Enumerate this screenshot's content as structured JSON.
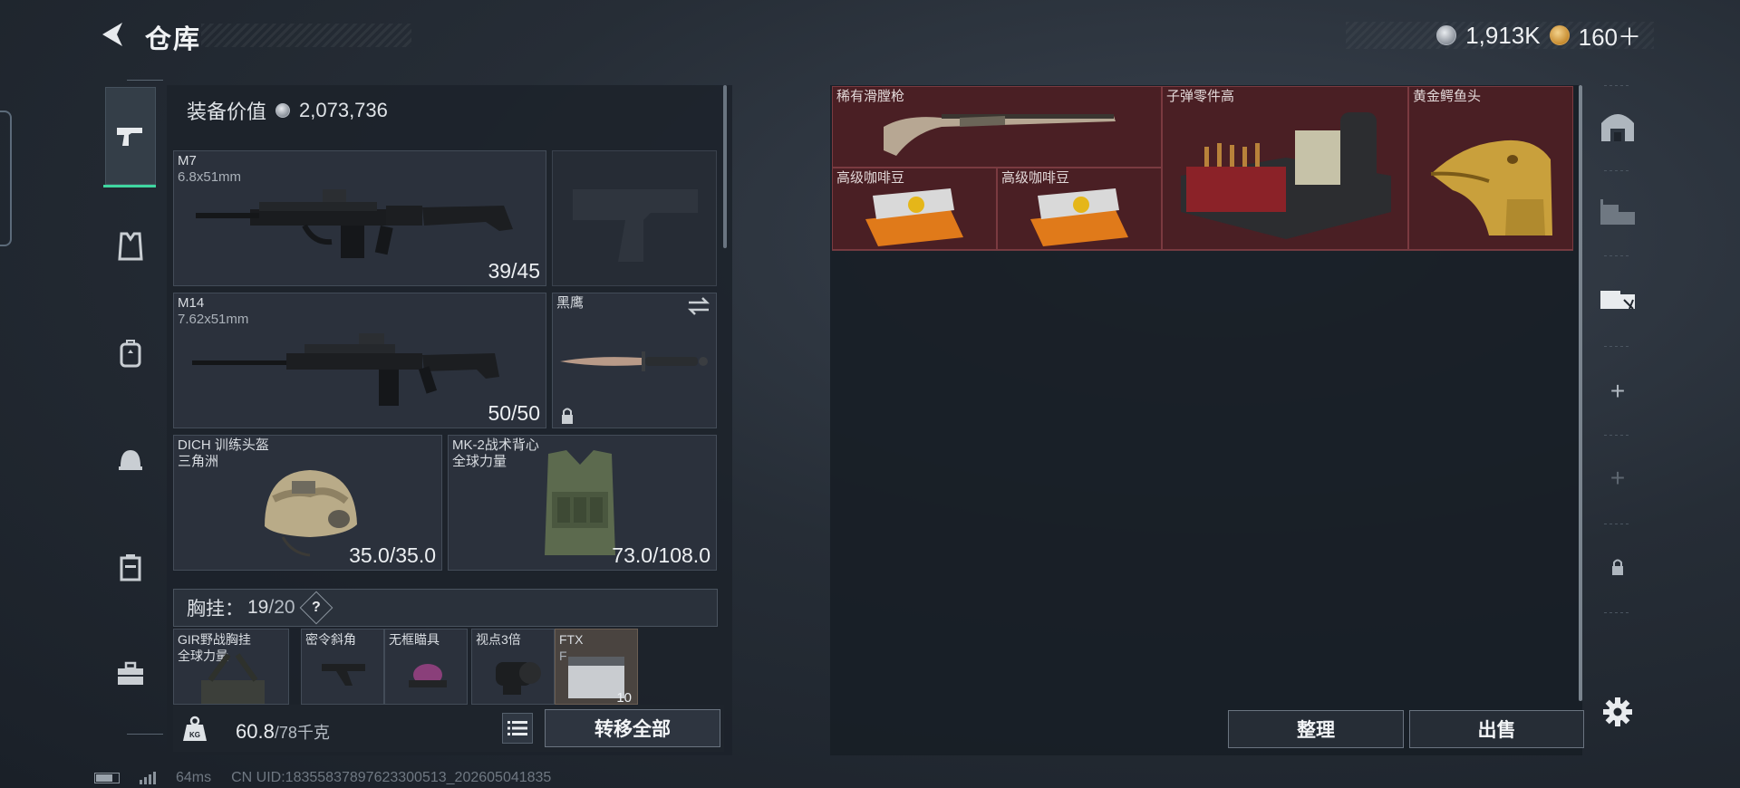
{
  "header": {
    "title": "仓库",
    "currency_silver": "1,913K",
    "currency_gold": "160＋"
  },
  "left": {
    "equip_value_label": "装备价值",
    "equip_value": "2,073,736",
    "weapons": [
      {
        "name": "M7",
        "caliber": "6.8x51mm",
        "count": "39/45"
      },
      {
        "name": "M14",
        "caliber": "7.62x51mm",
        "count": "50/50"
      }
    ],
    "melee": {
      "name": "黑鹰"
    },
    "helmet": {
      "name": "DICH 训练头盔",
      "sub": "三角洲",
      "durability": "35.0/35.0"
    },
    "vest": {
      "name": "MK-2战术背心",
      "sub": "全球力量",
      "durability": "73.0/108.0"
    },
    "chest_rig": {
      "label": "胸挂：",
      "current": "19",
      "capacity": "/20",
      "help": "?"
    },
    "chest_items": [
      {
        "name": "GIR野战胸挂",
        "sub": "全球力量"
      },
      {
        "name": "密令斜角"
      },
      {
        "name": "无框瞄具"
      },
      {
        "name": "视点3倍"
      },
      {
        "name": "FTX",
        "sub": "F",
        "count": "10"
      }
    ],
    "weight_current": "60.8",
    "weight_max": "/78千克",
    "transfer_all": "转移全部"
  },
  "right": {
    "items": [
      {
        "name": "稀有滑膛枪"
      },
      {
        "name": "子弹零件高"
      },
      {
        "name": "黄金鳄鱼头"
      },
      {
        "name": "高级咖啡豆"
      },
      {
        "name": "高级咖啡豆"
      }
    ],
    "sort": "整理",
    "sell": "出售"
  },
  "status": {
    "ping": "64ms",
    "uid": "CN UID:18355837897623300513_202605041835"
  },
  "colors": {
    "accent_active": "#3fd6a0",
    "rare_slot": "#4a1f24"
  },
  "icons": [
    "back-arrow-icon",
    "pistol-icon",
    "vest-icon",
    "backpack-icon",
    "helmet-icon",
    "case-icon",
    "toolbox-icon",
    "home-icon",
    "storage-icon",
    "gear-icon",
    "lock-icon",
    "weight-icon",
    "list-icon",
    "silver-coin-icon",
    "gold-coin-icon",
    "swap-icon",
    "help-icon"
  ]
}
